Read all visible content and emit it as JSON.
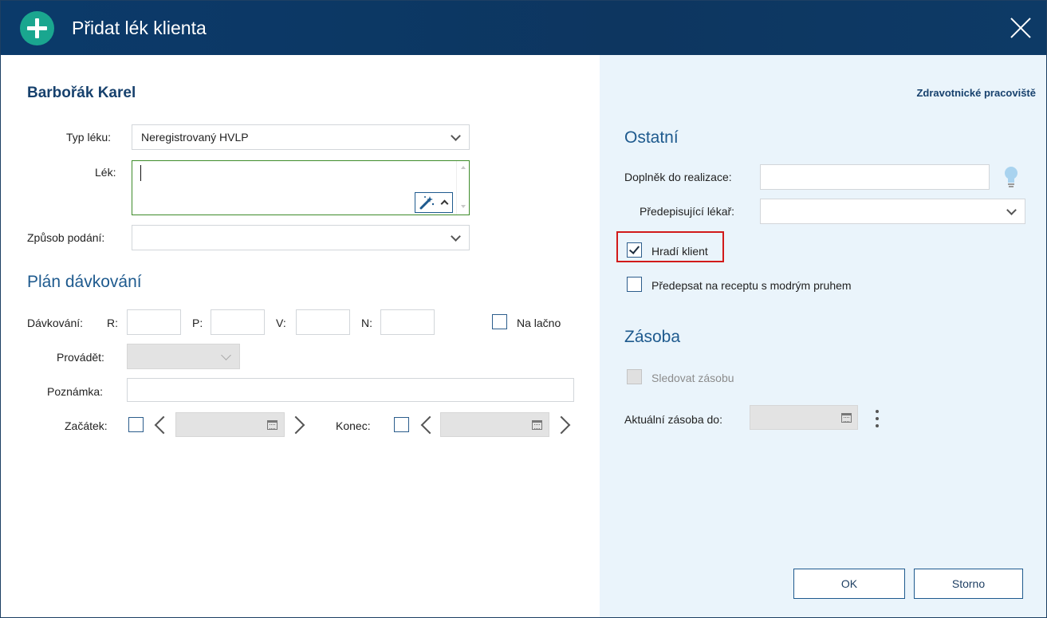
{
  "window": {
    "title": "Přidat lék klienta"
  },
  "client": {
    "name": "Barbořák Karel"
  },
  "drug": {
    "type_label": "Typ léku:",
    "type_value": "Neregistrovaný HVLP",
    "drug_label": "Lék:",
    "route_label": "Způsob podání:",
    "route_value": ""
  },
  "dosage": {
    "section_title": "Plán dávkování",
    "dosage_label": "Dávkování:",
    "r_label": "R:",
    "p_label": "P:",
    "v_label": "V:",
    "n_label": "N:",
    "r_value": "",
    "p_value": "",
    "v_value": "",
    "n_value": "",
    "fasting_label": "Na lačno",
    "fasting_checked": false,
    "perform_label": "Provádět:",
    "note_label": "Poznámka:",
    "note_value": "",
    "start_label": "Začátek:",
    "end_label": "Konec:"
  },
  "right": {
    "workplace_link": "Zdravotnické pracoviště",
    "other_title": "Ostatní",
    "supplement_label": "Doplněk do realizace:",
    "supplement_value": "",
    "doctor_label": "Předepisující lékař:",
    "doctor_value": "",
    "client_pays_label": "Hradí klient",
    "client_pays_checked": true,
    "blue_stripe_label": "Předepsat na receptu s modrým pruhem",
    "blue_stripe_checked": false,
    "stock_title": "Zásoba",
    "track_stock_label": "Sledovat zásobu",
    "track_stock_checked": false,
    "current_stock_label": "Aktuální zásoba do:"
  },
  "buttons": {
    "ok": "OK",
    "cancel": "Storno"
  },
  "colors": {
    "titlebar": "#0b3a6a",
    "accent": "#1aa68f",
    "highlight": "#d11a1a",
    "right_panel": "#eaf4fb"
  }
}
